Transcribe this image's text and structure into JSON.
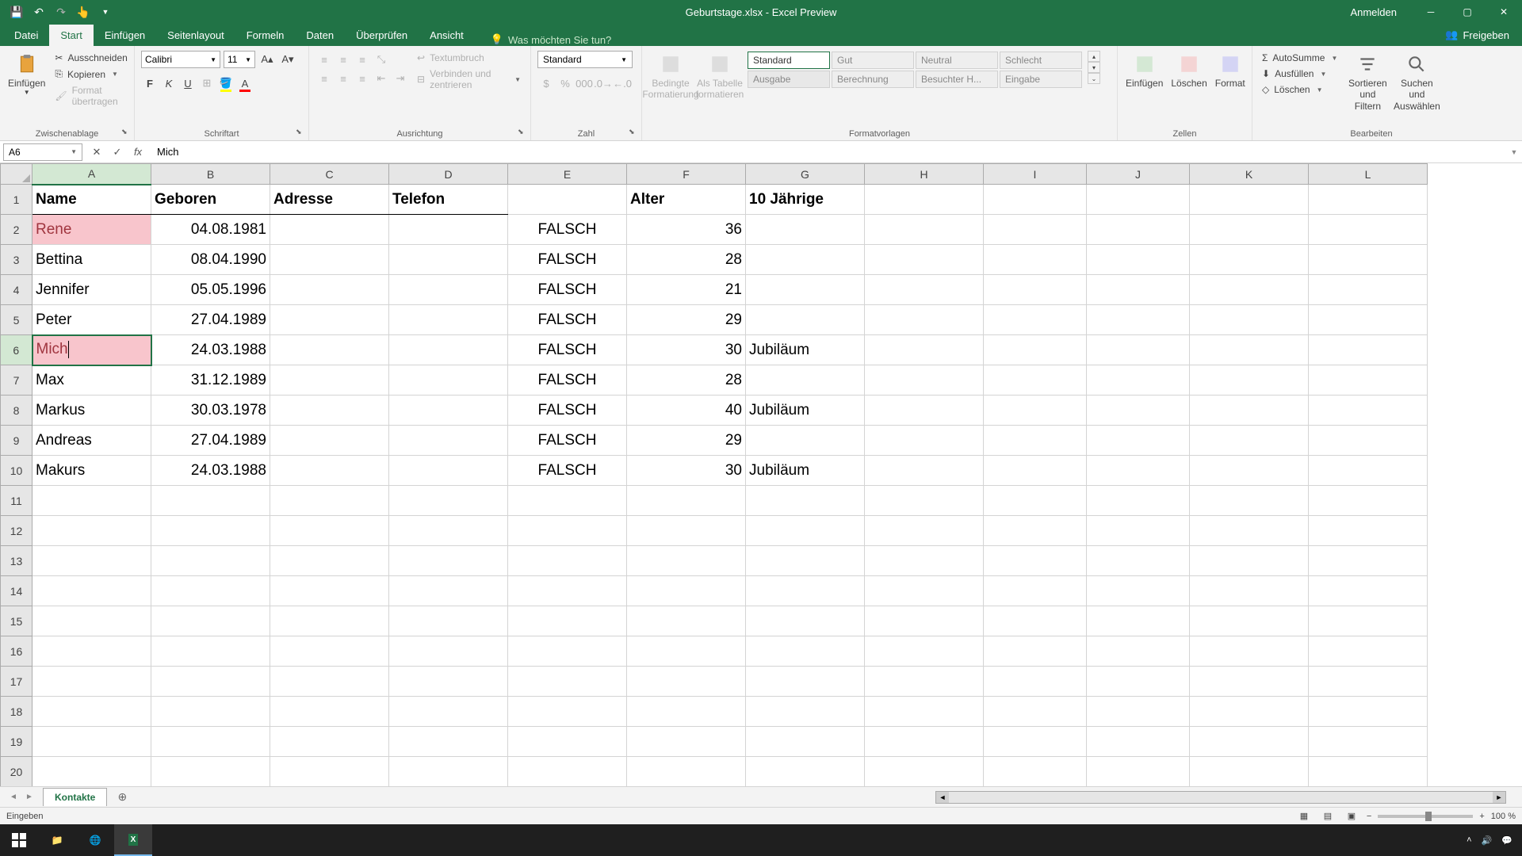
{
  "title_bar": {
    "app_title": "Geburtstage.xlsx - Excel Preview",
    "login": "Anmelden"
  },
  "ribbon_tabs": {
    "datei": "Datei",
    "start": "Start",
    "einfuegen": "Einfügen",
    "seitenlayout": "Seitenlayout",
    "formeln": "Formeln",
    "daten": "Daten",
    "ueberpruefen": "Überprüfen",
    "ansicht": "Ansicht",
    "tell_me": "Was möchten Sie tun?",
    "freigeben": "Freigeben"
  },
  "ribbon": {
    "einfuegen_btn": "Einfügen",
    "ausschneiden": "Ausschneiden",
    "kopieren": "Kopieren",
    "format_uebertragen": "Format übertragen",
    "zwischenablage": "Zwischenablage",
    "font_name": "Calibri",
    "font_size": "11",
    "schriftart": "Schriftart",
    "textumbruch": "Textumbruch",
    "verbinden": "Verbinden und zentrieren",
    "ausrichtung": "Ausrichtung",
    "number_format": "Standard",
    "zahl": "Zahl",
    "bedingte": "Bedingte Formatierung",
    "als_tabelle": "Als Tabelle formatieren",
    "style_standard": "Standard",
    "style_gut": "Gut",
    "style_neutral": "Neutral",
    "style_schlecht": "Schlecht",
    "style_ausgabe": "Ausgabe",
    "style_berechnung": "Berechnung",
    "style_besuchter": "Besuchter H...",
    "style_eingabe": "Eingabe",
    "formatvorlagen": "Formatvorlagen",
    "zellen_einfuegen": "Einfügen",
    "loeschen": "Löschen",
    "format": "Format",
    "zellen": "Zellen",
    "autosumme": "AutoSumme",
    "ausfuellen": "Ausfüllen",
    "leeren": "Löschen",
    "sortieren": "Sortieren und Filtern",
    "suchen": "Suchen und Auswählen",
    "bearbeiten": "Bearbeiten"
  },
  "formula_bar": {
    "name_box": "A6",
    "formula": "Mich"
  },
  "columns": [
    "A",
    "B",
    "C",
    "D",
    "E",
    "F",
    "G",
    "H",
    "I",
    "J",
    "K",
    "L"
  ],
  "headers": {
    "name": "Name",
    "geboren": "Geboren",
    "adresse": "Adresse",
    "telefon": "Telefon",
    "alter": "Alter",
    "jaehrige": "10 Jährige"
  },
  "rows": [
    {
      "r": 2,
      "name": "Rene",
      "geboren": "04.08.1981",
      "e": "FALSCH",
      "alter": "36",
      "g": "",
      "pink": true
    },
    {
      "r": 3,
      "name": "Bettina",
      "geboren": "08.04.1990",
      "e": "FALSCH",
      "alter": "28",
      "g": ""
    },
    {
      "r": 4,
      "name": "Jennifer",
      "geboren": "05.05.1996",
      "e": "FALSCH",
      "alter": "21",
      "g": ""
    },
    {
      "r": 5,
      "name": "Peter",
      "geboren": "27.04.1989",
      "e": "FALSCH",
      "alter": "29",
      "g": ""
    },
    {
      "r": 6,
      "name": "Mich",
      "geboren": "24.03.1988",
      "e": "FALSCH",
      "alter": "30",
      "g": "Jubiläum",
      "pink": true,
      "editing": true
    },
    {
      "r": 7,
      "name": "Max",
      "geboren": "31.12.1989",
      "e": "FALSCH",
      "alter": "28",
      "g": ""
    },
    {
      "r": 8,
      "name": "Markus",
      "geboren": "30.03.1978",
      "e": "FALSCH",
      "alter": "40",
      "g": "Jubiläum"
    },
    {
      "r": 9,
      "name": "Andreas",
      "geboren": "27.04.1989",
      "e": "FALSCH",
      "alter": "29",
      "g": ""
    },
    {
      "r": 10,
      "name": "Makurs",
      "geboren": "24.03.1988",
      "e": "FALSCH",
      "alter": "30",
      "g": "Jubiläum"
    }
  ],
  "empty_rows": [
    11,
    12,
    13,
    14,
    15,
    16,
    17,
    18,
    19,
    20
  ],
  "sheet_tab": "Kontakte",
  "status": "Eingeben",
  "zoom": "100 %"
}
